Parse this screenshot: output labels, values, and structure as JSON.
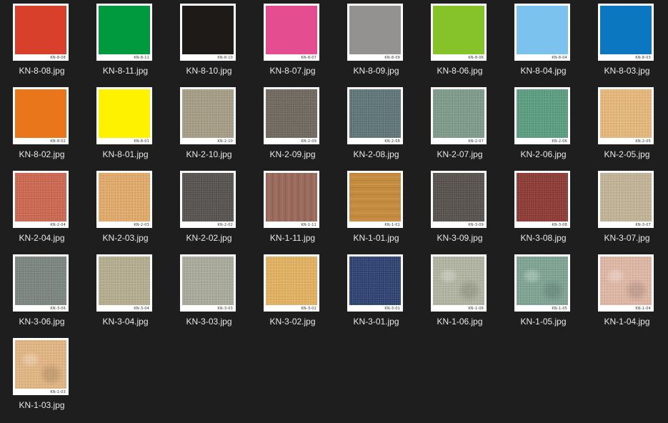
{
  "files": [
    {
      "name": "KN-8-08.jpg",
      "code": "KN-8-08",
      "color": "#d9402c",
      "texture": "none"
    },
    {
      "name": "KN-8-11.jpg",
      "code": "KN-8-11",
      "color": "#009a3e",
      "texture": "none"
    },
    {
      "name": "KN-8-10.jpg",
      "code": "KN-8-10",
      "color": "#1e1a18",
      "texture": "none"
    },
    {
      "name": "KN-8-07.jpg",
      "code": "KN-8-07",
      "color": "#e44e91",
      "texture": "none"
    },
    {
      "name": "KN-8-09.jpg",
      "code": "KN-8-09",
      "color": "#939291",
      "texture": "none"
    },
    {
      "name": "KN-8-06.jpg",
      "code": "KN-8-06",
      "color": "#86c22a",
      "texture": "none"
    },
    {
      "name": "KN-8-04.jpg",
      "code": "KN-8-04",
      "color": "#7cc2ee",
      "texture": "none"
    },
    {
      "name": "KN-8-03.jpg",
      "code": "KN-8-03",
      "color": "#0a77c0",
      "texture": "none"
    },
    {
      "name": "KN-8-02.jpg",
      "code": "KN-8-02",
      "color": "#e9761b",
      "texture": "none"
    },
    {
      "name": "KN-8-01.jpg",
      "code": "KN-8-01",
      "color": "#fff200",
      "texture": "none"
    },
    {
      "name": "KN-2-10.jpg",
      "code": "KN-2-10",
      "color": "#a69d86",
      "texture": "speckle"
    },
    {
      "name": "KN-2-09.jpg",
      "code": "KN-2-09",
      "color": "#6f685e",
      "texture": "speckle"
    },
    {
      "name": "KN-2-08.jpg",
      "code": "KN-2-08",
      "color": "#5e7677",
      "texture": "speckle"
    },
    {
      "name": "KN-2-07.jpg",
      "code": "KN-2-07",
      "color": "#7e9a8a",
      "texture": "speckle"
    },
    {
      "name": "KN-2-06.jpg",
      "code": "KN-2-06",
      "color": "#5a9d80",
      "texture": "speckle"
    },
    {
      "name": "KN-2-05.jpg",
      "code": "KN-2-05",
      "color": "#e6b77b",
      "texture": "speckle"
    },
    {
      "name": "KN-2-04.jpg",
      "code": "KN-2-04",
      "color": "#cc6750",
      "texture": "speckle"
    },
    {
      "name": "KN-2-03.jpg",
      "code": "KN-2-03",
      "color": "#e1aa6a",
      "texture": "speckle"
    },
    {
      "name": "KN-2-02.jpg",
      "code": "KN-2-02",
      "color": "#56524f",
      "texture": "speckle"
    },
    {
      "name": "KN-1-11.jpg",
      "code": "KN-1-11",
      "color": "#9a6a5c",
      "texture": "wood"
    },
    {
      "name": "KN-1-01.jpg",
      "code": "KN-1-01",
      "color": "#c48b3e",
      "texture": "woodh"
    },
    {
      "name": "KN-3-09.jpg",
      "code": "KN-3-09",
      "color": "#57514d",
      "texture": "speckle"
    },
    {
      "name": "KN-3-08.jpg",
      "code": "KN-3-08",
      "color": "#8e3a34",
      "texture": "speckle"
    },
    {
      "name": "KN-3-07.jpg",
      "code": "KN-3-07",
      "color": "#c2b397",
      "texture": "speckle"
    },
    {
      "name": "KN-3-06.jpg",
      "code": "KN-3-06",
      "color": "#7b857f",
      "texture": "speckle"
    },
    {
      "name": "KN-3-04.jpg",
      "code": "KN-3-04",
      "color": "#b4ad8f",
      "texture": "speckle"
    },
    {
      "name": "KN-3-03.jpg",
      "code": "KN-3-03",
      "color": "#a9aa9a",
      "texture": "speckle"
    },
    {
      "name": "KN-3-02.jpg",
      "code": "KN-3-02",
      "color": "#e2b160",
      "texture": "speckle"
    },
    {
      "name": "KN-3-01.jpg",
      "code": "KN-3-01",
      "color": "#2e4272",
      "texture": "speckle"
    },
    {
      "name": "KN-1-06.jpg",
      "code": "KN-1-06",
      "color": "#b1b3a1",
      "texture": "marble"
    },
    {
      "name": "KN-1-05.jpg",
      "code": "KN-1-05",
      "color": "#7ea393",
      "texture": "marble"
    },
    {
      "name": "KN-1-04.jpg",
      "code": "KN-1-04",
      "color": "#dfb6a4",
      "texture": "marble"
    },
    {
      "name": "KN-1-03.jpg",
      "code": "KN-1-03",
      "color": "#e1b582",
      "texture": "marble"
    }
  ],
  "background_color": "#1e1e1e",
  "label_color": "#e8e8e8"
}
